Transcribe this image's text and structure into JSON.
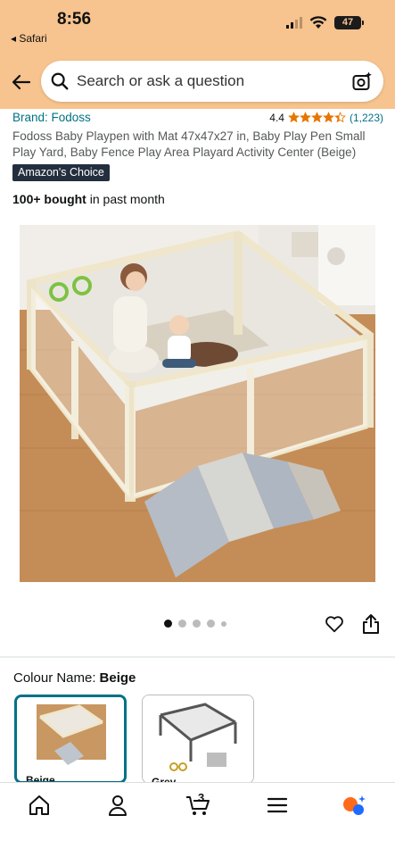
{
  "status": {
    "time": "8:56",
    "back_app": "◂ Safari",
    "battery": "47"
  },
  "search": {
    "placeholder": "Search or ask a question"
  },
  "product": {
    "brand": "Brand: Fodoss",
    "rating": "4.4",
    "rating_count": "(1,223)",
    "stars_filled": 4.4,
    "title": "Fodoss Baby Playpen with Mat 47x47x27 in, Baby Play Pen Small Play Yard, Baby Fence Play Area Playard Activity Center (Beige)",
    "badge": "Amazon's Choice",
    "bought_bold": "100+ bought",
    "bought_rest": " in past month"
  },
  "gallery": {
    "dot_count": 5,
    "active_index": 0
  },
  "colour": {
    "label": "Colour Name:",
    "value": "Beige",
    "options": [
      {
        "name": "Beige",
        "selected": true
      },
      {
        "name": "Grey",
        "selected": false
      }
    ]
  },
  "nav": {
    "items": [
      "home-icon",
      "account-icon",
      "cart-icon",
      "menu-icon",
      "rufus-icon"
    ],
    "cart_count": "3"
  },
  "colors": {
    "header": "#f7c38e",
    "link": "#007185",
    "badge": "#232f3e",
    "star": "#e77600",
    "rufus_orange": "#ff6a1a",
    "rufus_blue": "#1f6bff"
  }
}
